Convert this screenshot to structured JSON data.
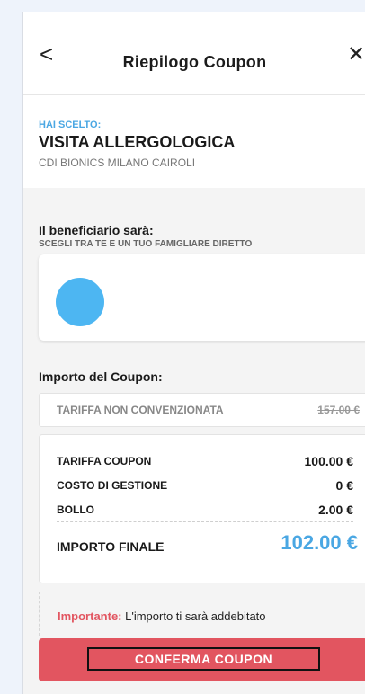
{
  "header": {
    "title": "Riepilogo Coupon",
    "back_icon": "<",
    "close_icon": "✕"
  },
  "chosen": {
    "label": "HAI SCELTO:",
    "visit": "VISITA ALLERGOLOGICA",
    "clinic": "CDI BIONICS MILANO CAIROLI"
  },
  "beneficiary": {
    "title": "Il beneficiario sarà:",
    "subtitle": "SCEGLI TRA TE E UN TUO FAMIGLIARE DIRETTO"
  },
  "amount": {
    "title": "Importo del Coupon:",
    "non_convenzionata_label": "TARIFFA NON CONVENZIONATA",
    "non_convenzionata_value": "157.00 €",
    "rows": [
      {
        "label": "TARIFFA COUPON",
        "value": "100.00 €"
      },
      {
        "label": "COSTO DI GESTIONE",
        "value": "0 €"
      },
      {
        "label": "BOLLO",
        "value": "2.00 €"
      }
    ],
    "final_label": "IMPORTO FINALE",
    "final_value": "102.00 €"
  },
  "notice": {
    "strong": "Importante:",
    "text": " L'importo ti sarà addebitato"
  },
  "confirm_button": {
    "label": "CONFERMA COUPON"
  },
  "colors": {
    "accent": "#4aa7e3",
    "button": "#e25560",
    "avatar": "#4db6f2"
  }
}
